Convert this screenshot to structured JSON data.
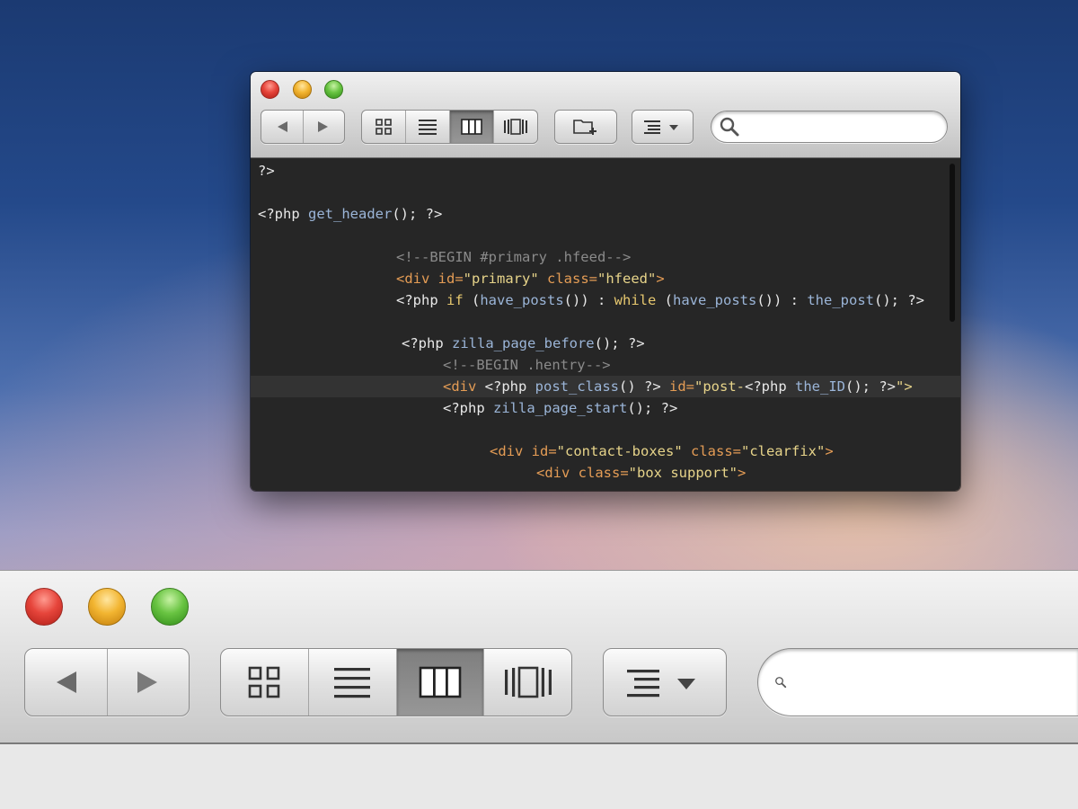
{
  "small_window": {
    "toolbar": {
      "back_icon": "triangle-left-icon",
      "forward_icon": "triangle-right-icon",
      "views": [
        "icon-view-icon",
        "list-view-icon",
        "column-view-icon",
        "cover-flow-view-icon"
      ],
      "active_view": "column-view-icon",
      "new_folder_icon": "new-folder-icon",
      "arrange_icon": "arrange-menu-icon",
      "search_placeholder": ""
    },
    "code_lines": [
      {
        "tokens": [
          {
            "t": "?>",
            "c": "plain"
          }
        ]
      },
      {
        "tokens": []
      },
      {
        "tokens": [
          {
            "t": "<?php ",
            "c": "plain"
          },
          {
            "t": "get_header",
            "c": "fn"
          },
          {
            "t": "(); ?>",
            "c": "plain"
          }
        ]
      },
      {
        "tokens": []
      },
      {
        "tokens": [
          {
            "t": "<!--BEGIN #primary .hfeed-->",
            "c": "comment"
          }
        ]
      },
      {
        "tokens": [
          {
            "t": "<div ",
            "c": "tag"
          },
          {
            "t": "id=",
            "c": "tag"
          },
          {
            "t": "\"primary\"",
            "c": "str"
          },
          {
            "t": " class=",
            "c": "tag"
          },
          {
            "t": "\"hfeed\"",
            "c": "str"
          },
          {
            "t": ">",
            "c": "tag"
          }
        ]
      },
      {
        "tokens": [
          {
            "t": "<?php ",
            "c": "plain"
          },
          {
            "t": "if ",
            "c": "kw"
          },
          {
            "t": "(",
            "c": "plain"
          },
          {
            "t": "have_posts",
            "c": "fn"
          },
          {
            "t": "()) : ",
            "c": "plain"
          },
          {
            "t": "while ",
            "c": "kw"
          },
          {
            "t": "(",
            "c": "plain"
          },
          {
            "t": "have_posts",
            "c": "fn"
          },
          {
            "t": "()) : ",
            "c": "plain"
          },
          {
            "t": "the_post",
            "c": "fn"
          },
          {
            "t": "(); ?>",
            "c": "plain"
          }
        ]
      },
      {
        "tokens": []
      },
      {
        "tokens": [
          {
            "t": "<?php ",
            "c": "plain"
          },
          {
            "t": "zilla_page_before",
            "c": "fn"
          },
          {
            "t": "(); ?>",
            "c": "plain"
          }
        ]
      },
      {
        "tokens": [
          {
            "t": "<!--BEGIN .hentry-->",
            "c": "comment"
          }
        ]
      },
      {
        "tokens": [
          {
            "t": "<div ",
            "c": "tag"
          },
          {
            "t": "<?php ",
            "c": "plain"
          },
          {
            "t": "post_class",
            "c": "fn"
          },
          {
            "t": "() ?> ",
            "c": "plain"
          },
          {
            "t": "id=",
            "c": "tag"
          },
          {
            "t": "\"post-",
            "c": "str"
          },
          {
            "t": "<?php ",
            "c": "plain"
          },
          {
            "t": "the_ID",
            "c": "fn"
          },
          {
            "t": "(); ?>",
            "c": "plain"
          },
          {
            "t": "\">",
            "c": "str"
          }
        ]
      },
      {
        "tokens": [
          {
            "t": "<?php ",
            "c": "plain"
          },
          {
            "t": "zilla_page_start",
            "c": "fn"
          },
          {
            "t": "(); ?>",
            "c": "plain"
          }
        ]
      },
      {
        "tokens": []
      },
      {
        "tokens": [
          {
            "t": "<div ",
            "c": "tag"
          },
          {
            "t": "id=",
            "c": "tag"
          },
          {
            "t": "\"contact-boxes\"",
            "c": "str"
          },
          {
            "t": " class=",
            "c": "tag"
          },
          {
            "t": "\"clearfix\"",
            "c": "str"
          },
          {
            "t": ">",
            "c": "tag"
          }
        ]
      },
      {
        "tokens": [
          {
            "t": "<div ",
            "c": "tag"
          },
          {
            "t": "class=",
            "c": "tag"
          },
          {
            "t": "\"box support\"",
            "c": "str"
          },
          {
            "t": ">",
            "c": "tag"
          }
        ]
      }
    ],
    "current_line": 10
  },
  "big_window": {
    "toolbar": {
      "back_icon": "triangle-left-icon",
      "forward_icon": "triangle-right-icon",
      "views": [
        "icon-view-icon",
        "list-view-icon",
        "column-view-icon",
        "cover-flow-view-icon"
      ],
      "active_view": "column-view-icon",
      "arrange_icon": "arrange-menu-icon",
      "search_placeholder": ""
    }
  },
  "colors": {
    "code_background": "#262626",
    "code_function": "#9bb5d8",
    "code_tag": "#e49c55",
    "code_string": "#e7d48a",
    "code_keyword": "#e7c86f",
    "code_comment": "#8a8a8a"
  }
}
